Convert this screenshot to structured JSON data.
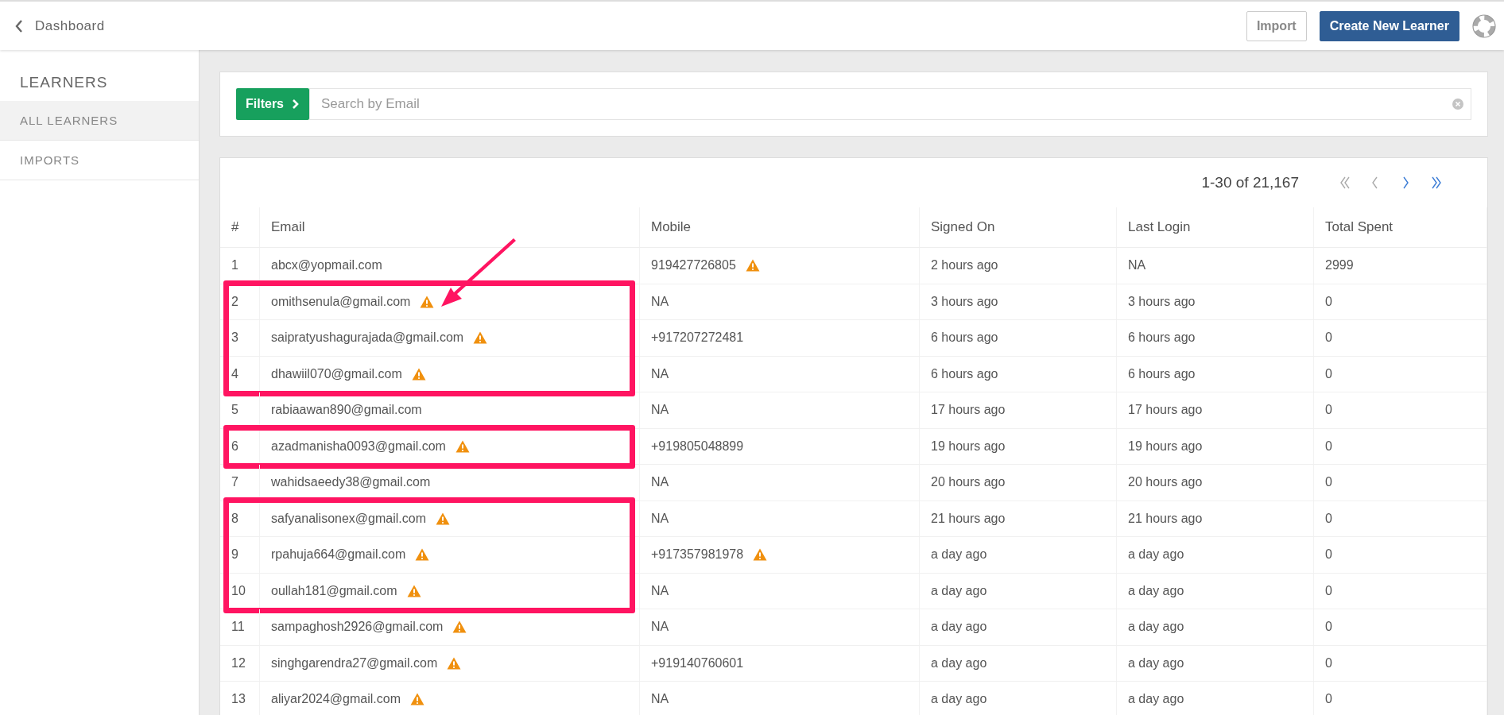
{
  "header": {
    "back_label": "Dashboard",
    "buttons": [
      {
        "label": "Import",
        "kind": "secondary"
      },
      {
        "label": "Create New Learner",
        "kind": "primary"
      }
    ]
  },
  "sidebar": {
    "title": "LEARNERS",
    "items": [
      {
        "label": "ALL LEARNERS",
        "selected": true
      },
      {
        "label": "IMPORTS",
        "selected": false
      }
    ]
  },
  "filter_bar": {
    "filters_label": "Filters",
    "search": {
      "placeholder": "Search by Email"
    }
  },
  "pagination": {
    "range": "1-30 of 21,167",
    "pagers": [
      {
        "kind": "first",
        "disabled": true
      },
      {
        "kind": "prev",
        "disabled": true
      },
      {
        "kind": "next",
        "disabled": false
      },
      {
        "kind": "last",
        "disabled": false
      }
    ]
  },
  "table": {
    "columns": [
      "#",
      "Email",
      "Mobile",
      "Signed On",
      "Last Login",
      "Total Spent"
    ],
    "rows": [
      {
        "num": "1",
        "email": "abcx@yopmail.com",
        "email_warning": false,
        "mobile": "919427726805",
        "mobile_warning": true,
        "signed_on": "2 hours ago",
        "last_login": "NA",
        "total_spent": "2999",
        "highlighted": false,
        "arrow": false
      },
      {
        "num": "2",
        "email": "omithsenula@gmail.com",
        "email_warning": true,
        "mobile": "NA",
        "mobile_warning": false,
        "signed_on": "3 hours ago",
        "last_login": "3 hours ago",
        "total_spent": "0",
        "highlighted": true,
        "arrow": true
      },
      {
        "num": "3",
        "email": "saipratyushagurajada@gmail.com",
        "email_warning": true,
        "mobile": "+917207272481",
        "mobile_warning": false,
        "signed_on": "6 hours ago",
        "last_login": "6 hours ago",
        "total_spent": "0",
        "highlighted": true,
        "arrow": false
      },
      {
        "num": "4",
        "email": "dhawiil070@gmail.com",
        "email_warning": true,
        "mobile": "NA",
        "mobile_warning": false,
        "signed_on": "6 hours ago",
        "last_login": "6 hours ago",
        "total_spent": "0",
        "highlighted": true,
        "arrow": false
      },
      {
        "num": "5",
        "email": "rabiaawan890@gmail.com",
        "email_warning": false,
        "mobile": "NA",
        "mobile_warning": false,
        "signed_on": "17 hours ago",
        "last_login": "17 hours ago",
        "total_spent": "0",
        "highlighted": false,
        "arrow": false
      },
      {
        "num": "6",
        "email": "azadmanisha0093@gmail.com",
        "email_warning": true,
        "mobile": "+919805048899",
        "mobile_warning": false,
        "signed_on": "19 hours ago",
        "last_login": "19 hours ago",
        "total_spent": "0",
        "highlighted": true,
        "arrow": false
      },
      {
        "num": "7",
        "email": "wahidsaeedy38@gmail.com",
        "email_warning": false,
        "mobile": "NA",
        "mobile_warning": false,
        "signed_on": "20 hours ago",
        "last_login": "20 hours ago",
        "total_spent": "0",
        "highlighted": false,
        "arrow": false
      },
      {
        "num": "8",
        "email": "safyanalisonex@gmail.com",
        "email_warning": true,
        "mobile": "NA",
        "mobile_warning": false,
        "signed_on": "21 hours ago",
        "last_login": "21 hours ago",
        "total_spent": "0",
        "highlighted": true,
        "arrow": false
      },
      {
        "num": "9",
        "email": "rpahuja664@gmail.com",
        "email_warning": true,
        "mobile": "+917357981978",
        "mobile_warning": true,
        "signed_on": "a day ago",
        "last_login": "a day ago",
        "total_spent": "0",
        "highlighted": true,
        "arrow": false
      },
      {
        "num": "10",
        "email": "oullah181@gmail.com",
        "email_warning": true,
        "mobile": "NA",
        "mobile_warning": false,
        "signed_on": "a day ago",
        "last_login": "a day ago",
        "total_spent": "0",
        "highlighted": true,
        "arrow": false
      },
      {
        "num": "11",
        "email": "sampaghosh2926@gmail.com",
        "email_warning": true,
        "mobile": "NA",
        "mobile_warning": false,
        "signed_on": "a day ago",
        "last_login": "a day ago",
        "total_spent": "0",
        "highlighted": false,
        "arrow": false
      },
      {
        "num": "12",
        "email": "singhgarendra27@gmail.com",
        "email_warning": true,
        "mobile": "+919140760601",
        "mobile_warning": false,
        "signed_on": "a day ago",
        "last_login": "a day ago",
        "total_spent": "0",
        "highlighted": false,
        "arrow": false
      },
      {
        "num": "13",
        "email": "aliyar2024@gmail.com",
        "email_warning": true,
        "mobile": "NA",
        "mobile_warning": false,
        "signed_on": "a day ago",
        "last_login": "a day ago",
        "total_spent": "0",
        "highlighted": false,
        "arrow": false
      }
    ]
  }
}
